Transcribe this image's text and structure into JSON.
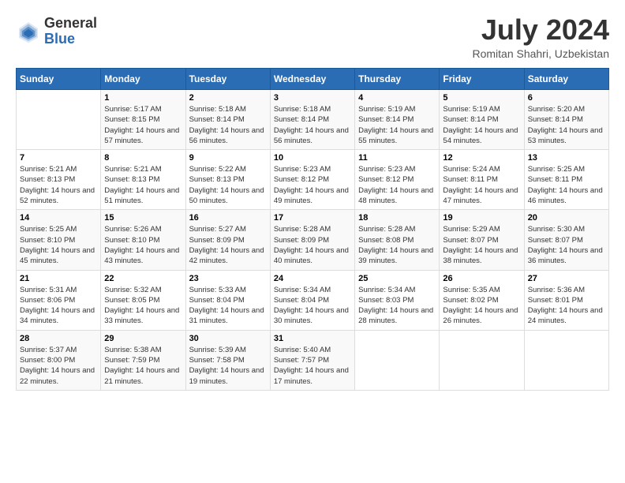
{
  "header": {
    "logo_general": "General",
    "logo_blue": "Blue",
    "month_year": "July 2024",
    "location": "Romitan Shahri, Uzbekistan"
  },
  "days_of_week": [
    "Sunday",
    "Monday",
    "Tuesday",
    "Wednesday",
    "Thursday",
    "Friday",
    "Saturday"
  ],
  "weeks": [
    [
      {
        "day": "",
        "sunrise": "",
        "sunset": "",
        "daylight": ""
      },
      {
        "day": "1",
        "sunrise": "Sunrise: 5:17 AM",
        "sunset": "Sunset: 8:15 PM",
        "daylight": "Daylight: 14 hours and 57 minutes."
      },
      {
        "day": "2",
        "sunrise": "Sunrise: 5:18 AM",
        "sunset": "Sunset: 8:14 PM",
        "daylight": "Daylight: 14 hours and 56 minutes."
      },
      {
        "day": "3",
        "sunrise": "Sunrise: 5:18 AM",
        "sunset": "Sunset: 8:14 PM",
        "daylight": "Daylight: 14 hours and 56 minutes."
      },
      {
        "day": "4",
        "sunrise": "Sunrise: 5:19 AM",
        "sunset": "Sunset: 8:14 PM",
        "daylight": "Daylight: 14 hours and 55 minutes."
      },
      {
        "day": "5",
        "sunrise": "Sunrise: 5:19 AM",
        "sunset": "Sunset: 8:14 PM",
        "daylight": "Daylight: 14 hours and 54 minutes."
      },
      {
        "day": "6",
        "sunrise": "Sunrise: 5:20 AM",
        "sunset": "Sunset: 8:14 PM",
        "daylight": "Daylight: 14 hours and 53 minutes."
      }
    ],
    [
      {
        "day": "7",
        "sunrise": "Sunrise: 5:21 AM",
        "sunset": "Sunset: 8:13 PM",
        "daylight": "Daylight: 14 hours and 52 minutes."
      },
      {
        "day": "8",
        "sunrise": "Sunrise: 5:21 AM",
        "sunset": "Sunset: 8:13 PM",
        "daylight": "Daylight: 14 hours and 51 minutes."
      },
      {
        "day": "9",
        "sunrise": "Sunrise: 5:22 AM",
        "sunset": "Sunset: 8:13 PM",
        "daylight": "Daylight: 14 hours and 50 minutes."
      },
      {
        "day": "10",
        "sunrise": "Sunrise: 5:23 AM",
        "sunset": "Sunset: 8:12 PM",
        "daylight": "Daylight: 14 hours and 49 minutes."
      },
      {
        "day": "11",
        "sunrise": "Sunrise: 5:23 AM",
        "sunset": "Sunset: 8:12 PM",
        "daylight": "Daylight: 14 hours and 48 minutes."
      },
      {
        "day": "12",
        "sunrise": "Sunrise: 5:24 AM",
        "sunset": "Sunset: 8:11 PM",
        "daylight": "Daylight: 14 hours and 47 minutes."
      },
      {
        "day": "13",
        "sunrise": "Sunrise: 5:25 AM",
        "sunset": "Sunset: 8:11 PM",
        "daylight": "Daylight: 14 hours and 46 minutes."
      }
    ],
    [
      {
        "day": "14",
        "sunrise": "Sunrise: 5:25 AM",
        "sunset": "Sunset: 8:10 PM",
        "daylight": "Daylight: 14 hours and 45 minutes."
      },
      {
        "day": "15",
        "sunrise": "Sunrise: 5:26 AM",
        "sunset": "Sunset: 8:10 PM",
        "daylight": "Daylight: 14 hours and 43 minutes."
      },
      {
        "day": "16",
        "sunrise": "Sunrise: 5:27 AM",
        "sunset": "Sunset: 8:09 PM",
        "daylight": "Daylight: 14 hours and 42 minutes."
      },
      {
        "day": "17",
        "sunrise": "Sunrise: 5:28 AM",
        "sunset": "Sunset: 8:09 PM",
        "daylight": "Daylight: 14 hours and 40 minutes."
      },
      {
        "day": "18",
        "sunrise": "Sunrise: 5:28 AM",
        "sunset": "Sunset: 8:08 PM",
        "daylight": "Daylight: 14 hours and 39 minutes."
      },
      {
        "day": "19",
        "sunrise": "Sunrise: 5:29 AM",
        "sunset": "Sunset: 8:07 PM",
        "daylight": "Daylight: 14 hours and 38 minutes."
      },
      {
        "day": "20",
        "sunrise": "Sunrise: 5:30 AM",
        "sunset": "Sunset: 8:07 PM",
        "daylight": "Daylight: 14 hours and 36 minutes."
      }
    ],
    [
      {
        "day": "21",
        "sunrise": "Sunrise: 5:31 AM",
        "sunset": "Sunset: 8:06 PM",
        "daylight": "Daylight: 14 hours and 34 minutes."
      },
      {
        "day": "22",
        "sunrise": "Sunrise: 5:32 AM",
        "sunset": "Sunset: 8:05 PM",
        "daylight": "Daylight: 14 hours and 33 minutes."
      },
      {
        "day": "23",
        "sunrise": "Sunrise: 5:33 AM",
        "sunset": "Sunset: 8:04 PM",
        "daylight": "Daylight: 14 hours and 31 minutes."
      },
      {
        "day": "24",
        "sunrise": "Sunrise: 5:34 AM",
        "sunset": "Sunset: 8:04 PM",
        "daylight": "Daylight: 14 hours and 30 minutes."
      },
      {
        "day": "25",
        "sunrise": "Sunrise: 5:34 AM",
        "sunset": "Sunset: 8:03 PM",
        "daylight": "Daylight: 14 hours and 28 minutes."
      },
      {
        "day": "26",
        "sunrise": "Sunrise: 5:35 AM",
        "sunset": "Sunset: 8:02 PM",
        "daylight": "Daylight: 14 hours and 26 minutes."
      },
      {
        "day": "27",
        "sunrise": "Sunrise: 5:36 AM",
        "sunset": "Sunset: 8:01 PM",
        "daylight": "Daylight: 14 hours and 24 minutes."
      }
    ],
    [
      {
        "day": "28",
        "sunrise": "Sunrise: 5:37 AM",
        "sunset": "Sunset: 8:00 PM",
        "daylight": "Daylight: 14 hours and 22 minutes."
      },
      {
        "day": "29",
        "sunrise": "Sunrise: 5:38 AM",
        "sunset": "Sunset: 7:59 PM",
        "daylight": "Daylight: 14 hours and 21 minutes."
      },
      {
        "day": "30",
        "sunrise": "Sunrise: 5:39 AM",
        "sunset": "Sunset: 7:58 PM",
        "daylight": "Daylight: 14 hours and 19 minutes."
      },
      {
        "day": "31",
        "sunrise": "Sunrise: 5:40 AM",
        "sunset": "Sunset: 7:57 PM",
        "daylight": "Daylight: 14 hours and 17 minutes."
      },
      {
        "day": "",
        "sunrise": "",
        "sunset": "",
        "daylight": ""
      },
      {
        "day": "",
        "sunrise": "",
        "sunset": "",
        "daylight": ""
      },
      {
        "day": "",
        "sunrise": "",
        "sunset": "",
        "daylight": ""
      }
    ]
  ]
}
